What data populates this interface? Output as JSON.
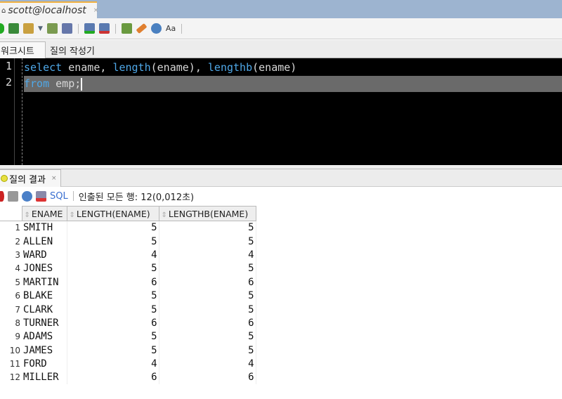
{
  "window": {
    "tab_title": "scott@localhost",
    "tab_close": "×"
  },
  "worksheet_tabs": [
    {
      "label": "워크시트"
    },
    {
      "label": "질의 작성기"
    }
  ],
  "editor": {
    "line_numbers": [
      "1",
      "2"
    ],
    "lines": [
      [
        {
          "t": "select",
          "kw": true
        },
        {
          "t": " ename, ",
          "kw": false
        },
        {
          "t": "length",
          "kw": true
        },
        {
          "t": "(ename), ",
          "kw": false
        },
        {
          "t": "lengthb",
          "kw": true
        },
        {
          "t": "(ename)",
          "kw": false
        }
      ],
      [
        {
          "t": "from",
          "kw": true
        },
        {
          "t": " emp;",
          "kw": false
        }
      ]
    ]
  },
  "colors": {
    "keyword": "#4fa8e8",
    "editor_bg": "#000000",
    "current_line": "#6a6a6a"
  },
  "results": {
    "tab_label": "질의 결과",
    "tab_close": "×",
    "sql_label": "SQL",
    "status": "인출된 모든 행: 12(0,012초)",
    "columns": [
      "ENAME",
      "LENGTH(ENAME)",
      "LENGTHB(ENAME)"
    ],
    "rows": [
      [
        "1",
        "SMITH",
        "5",
        "5"
      ],
      [
        "2",
        "ALLEN",
        "5",
        "5"
      ],
      [
        "3",
        "WARD",
        "4",
        "4"
      ],
      [
        "4",
        "JONES",
        "5",
        "5"
      ],
      [
        "5",
        "MARTIN",
        "6",
        "6"
      ],
      [
        "6",
        "BLAKE",
        "5",
        "5"
      ],
      [
        "7",
        "CLARK",
        "5",
        "5"
      ],
      [
        "8",
        "TURNER",
        "6",
        "6"
      ],
      [
        "9",
        "ADAMS",
        "5",
        "5"
      ],
      [
        "10",
        "JAMES",
        "5",
        "5"
      ],
      [
        "11",
        "FORD",
        "4",
        "4"
      ],
      [
        "12",
        "MILLER",
        "6",
        "6"
      ]
    ]
  }
}
